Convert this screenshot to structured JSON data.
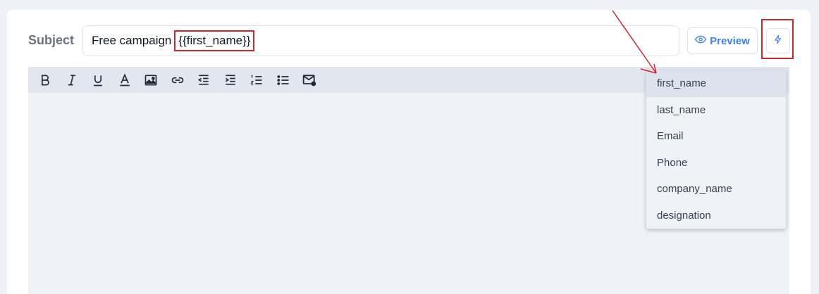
{
  "subject": {
    "label": "Subject",
    "value_text": "Free campaign",
    "placeholder_token": "{{first_name}}"
  },
  "preview_button": {
    "label": "Preview",
    "icon": "eye-icon"
  },
  "placeholder_button": {
    "icon": "lightning-icon"
  },
  "toolbar": {
    "buttons": [
      "bold",
      "italic",
      "underline",
      "font-color",
      "image",
      "link",
      "outdent",
      "indent",
      "ordered-list",
      "bullet-list",
      "email-template"
    ]
  },
  "placeholder_menu": {
    "items": [
      "first_name",
      "last_name",
      "Email",
      "Phone",
      "company_name",
      "designation"
    ],
    "highlighted": "first_name"
  },
  "colors": {
    "accent": "#3b82f6",
    "highlight_outline": "#d0262e",
    "editor_bg": "#eff2f7",
    "toolbar_bg": "#e2e7ef"
  }
}
